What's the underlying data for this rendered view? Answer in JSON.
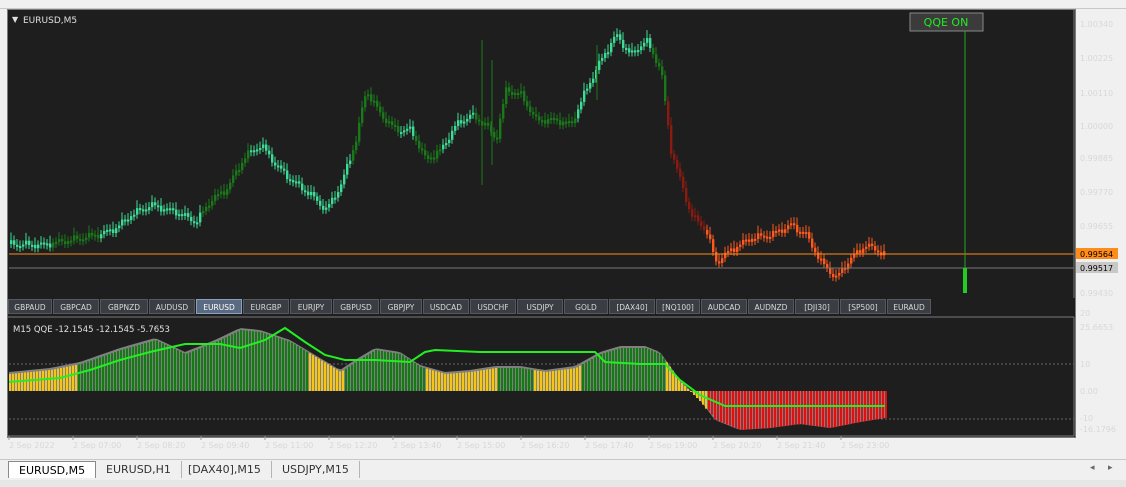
{
  "chart": {
    "title": "EURUSD,M5",
    "qqe_button_label": "QQE ON",
    "price_ticks": [
      "1.00340",
      "1.00225",
      "1.00110",
      "1.00000",
      "0.99885",
      "0.99770",
      "0.99655",
      "0.99430"
    ],
    "current_price_label": "0.99564",
    "line_price_label": "0.99517",
    "indicator_label": "M15 QQE -12.1545 -12.1545 -5.7653",
    "indicator_ticks": [
      "20",
      "25.6653",
      "10",
      "0.00",
      "-10",
      "-16.1796"
    ],
    "time_labels": [
      "2 Sep 2022",
      "2 Sep 07:00",
      "2 Sep 08:20",
      "2 Sep 09:40",
      "2 Sep 11:00",
      "2 Sep 12:20",
      "2 Sep 13:40",
      "2 Sep 15:00",
      "2 Sep 16:20",
      "2 Sep 17:40",
      "2 Sep 19:00",
      "2 Sep 20:20",
      "2 Sep 21:40",
      "2 Sep 23:00"
    ],
    "colors": {
      "bg": "#1e1e1e",
      "bull_light": "#3ddc97",
      "bull_dark": "#1a7a1a",
      "bear_dark": "#8b1a10",
      "bear_light": "#ff5a1e",
      "price_line": "#ff8c1a",
      "qqe_line": "#22ee22",
      "qqe_area": "#808080",
      "hist_green": "#157a15",
      "hist_yellow": "#f5c518",
      "hist_red": "#dd1111"
    }
  },
  "symbol_buttons": [
    "GBPAUD",
    "GBPCAD",
    "GBPNZD",
    "AUDUSD",
    "EURUSD",
    "EURGBP",
    "EURJPY",
    "GBPUSD",
    "GBPJPY",
    "USDCAD",
    "USDCHF",
    "USDJPY",
    "GOLD",
    "[DAX40]",
    "[NQ100]",
    "AUDCAD",
    "AUDNZD",
    "[DJI30]",
    "[SP500]",
    "EURAUD"
  ],
  "active_symbol": "EURUSD",
  "tabs": [
    "EURUSD,M5",
    "EURUSD,H1",
    "[DAX40],M15",
    "USDJPY,M15"
  ],
  "active_tab": "EURUSD,M5",
  "scroll_left": "◂",
  "scroll_right": "▸"
}
